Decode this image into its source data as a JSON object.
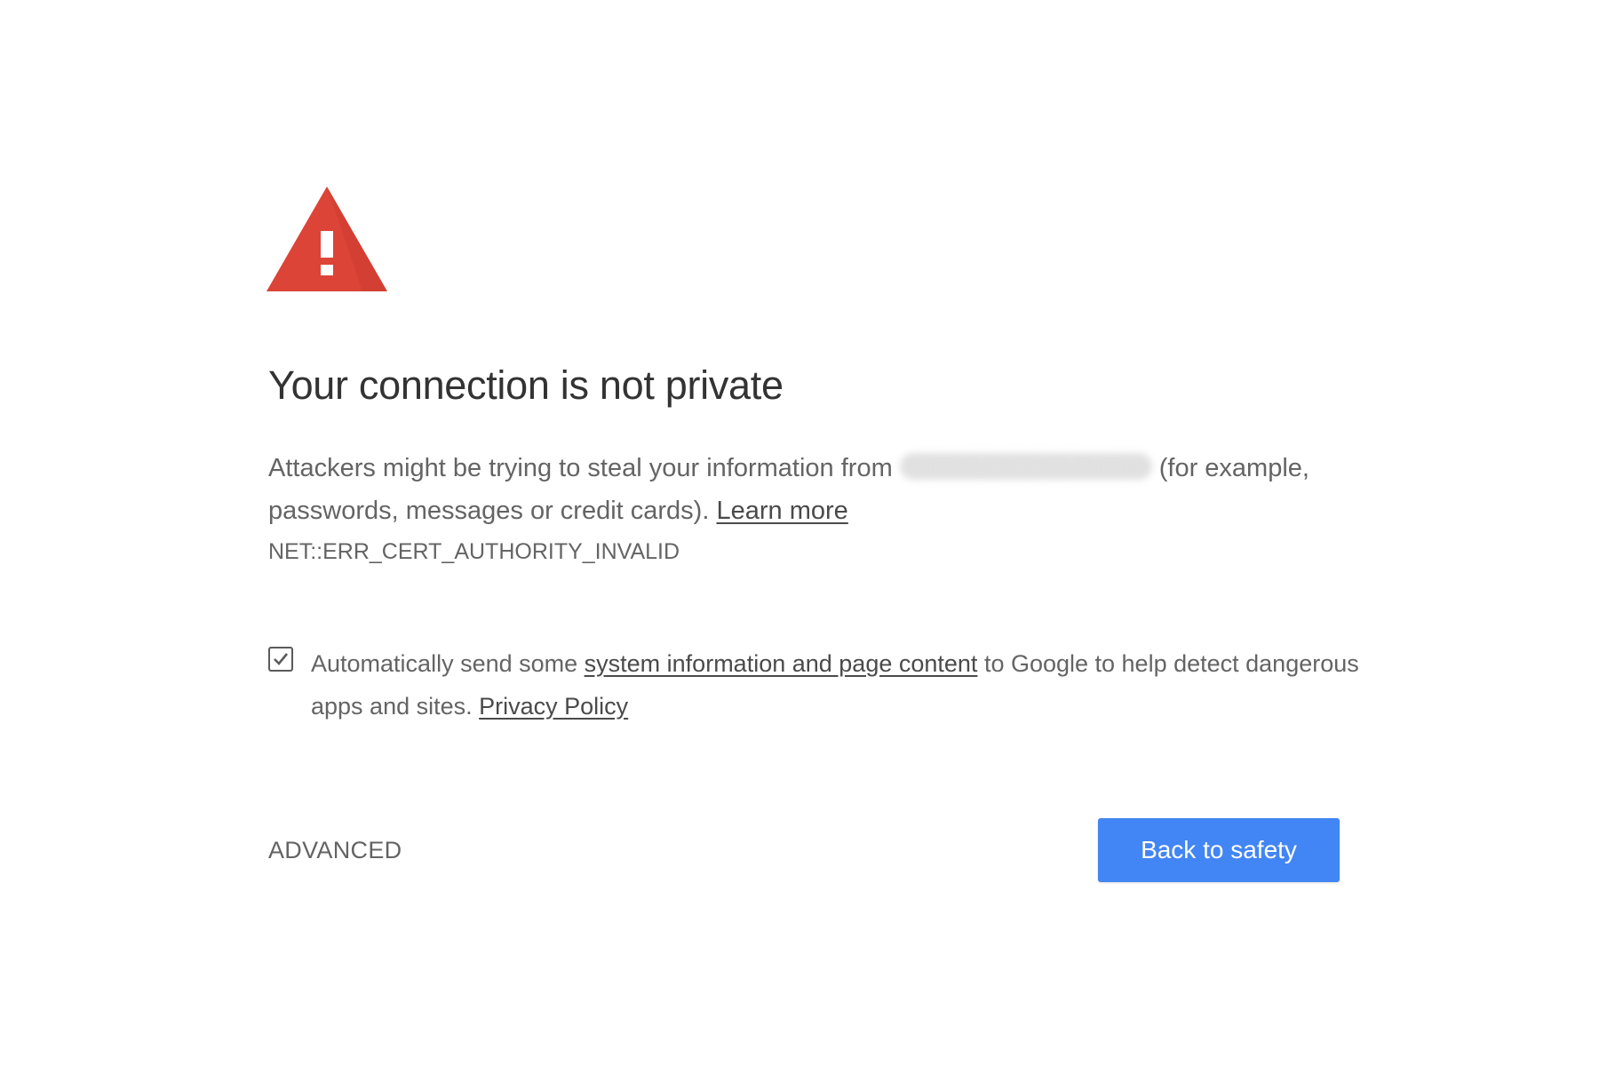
{
  "warning_icon": "warning-triangle-icon",
  "title": "Your connection is not private",
  "explanation": {
    "text_before": "Attackers might be trying to steal your information from",
    "text_after": "(for example, passwords, messages or credit cards).",
    "learn_more": "Learn more"
  },
  "error_code": "NET::ERR_CERT_AUTHORITY_INVALID",
  "reporting": {
    "checked": true,
    "text_before": "Automatically send some",
    "link_system_info": "system information and page content",
    "text_middle": "to Google to help detect dangerous apps and sites.",
    "link_privacy": "Privacy Policy"
  },
  "buttons": {
    "advanced": "ADVANCED",
    "back_to_safety": "Back to safety"
  },
  "colors": {
    "warning_red": "#db4437",
    "primary_blue": "#4285f4",
    "title_text": "#333333",
    "body_text": "#646464"
  }
}
